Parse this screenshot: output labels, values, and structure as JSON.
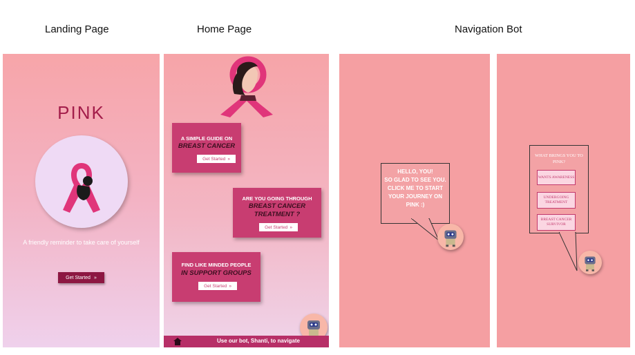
{
  "captions": {
    "landing": "Landing Page",
    "home": "Home Page",
    "bot": "Navigation Bot"
  },
  "landing": {
    "logo": "PINK",
    "tagline": "A friendly reminder to take care of yourself",
    "cta": "Get Started"
  },
  "home": {
    "cards": [
      {
        "line1": "A SIMPLE GUIDE ON",
        "line2": "BREAST CANCER",
        "line3": "",
        "button": "Get Started"
      },
      {
        "line1": "ARE YOU GOING THROUGH",
        "line2": "BREAST CANCER",
        "line3": "TREATMENT ?",
        "button": "Get Started"
      },
      {
        "line1": "FIND LIKE MINDED PEOPLE",
        "line2": "IN SUPPORT GROUPS",
        "line3": "",
        "button": "Get Started"
      }
    ],
    "footer_text": "Use our bot, Shanti, to navigate"
  },
  "bot1": {
    "lines": [
      "HELLO, YOU!",
      "SO GLAD TO SEE YOU.",
      "CLICK ME TO START",
      "YOUR JOURNEY ON",
      "PINK :)"
    ]
  },
  "bot2": {
    "question": "WHAT BRINGS YOU TO PINK?",
    "options": [
      "WANTS AWARENESS",
      "UNDERGOING TREATMENT",
      "BREAST CANCER SURVIVOR"
    ]
  },
  "colors": {
    "pink_card": "#c83d71",
    "dark_button": "#8d1742",
    "logo": "#a31d4a",
    "bot_bg": "#f59fa2"
  },
  "icons": [
    "ribbon-icon",
    "woman-ribbon-icon",
    "robot-icon",
    "home-icon",
    "double-chevron-icon"
  ]
}
